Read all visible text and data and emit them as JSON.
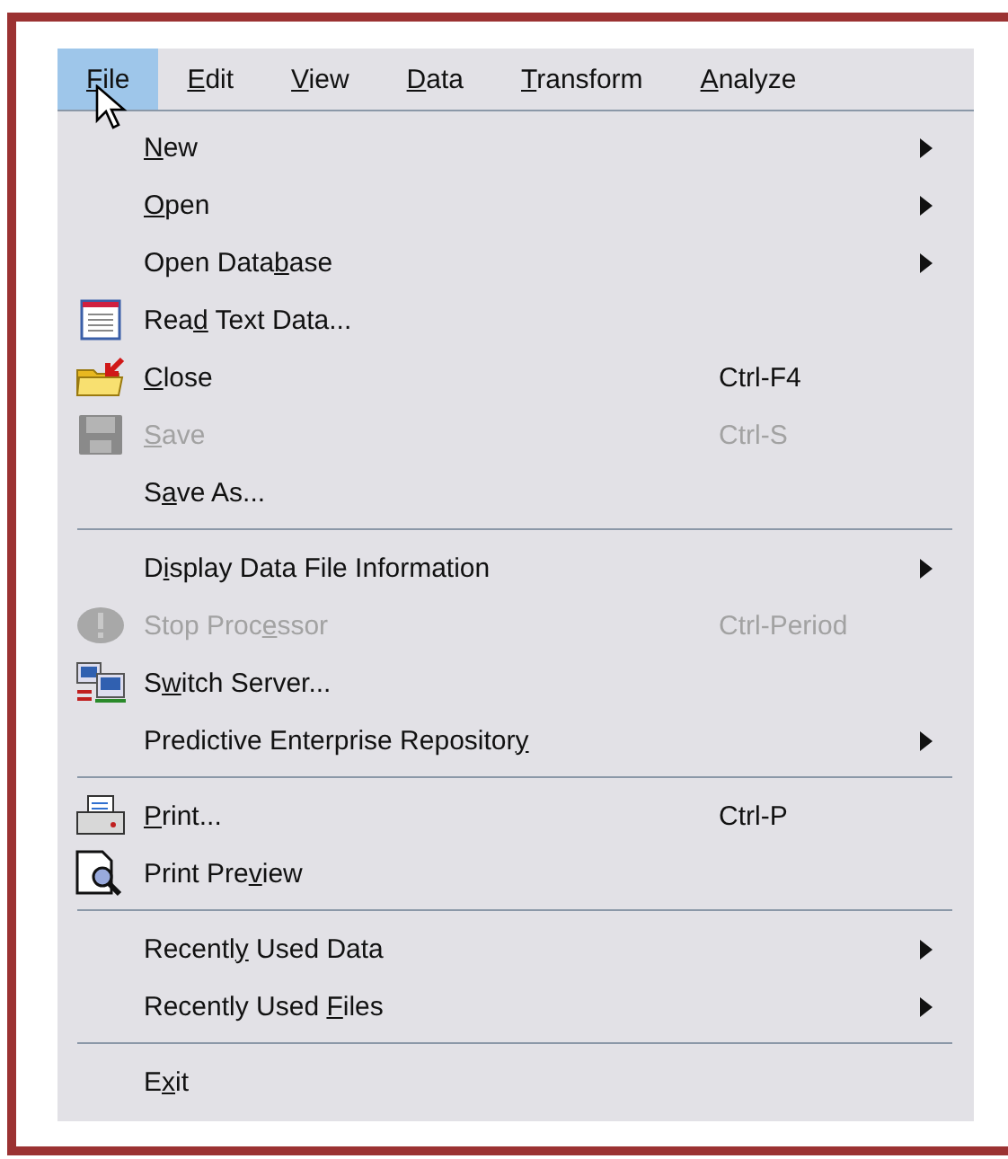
{
  "menubar": [
    {
      "mnemonic": "F",
      "label_rest": "ile",
      "selected": true
    },
    {
      "mnemonic": "E",
      "label_rest": "dit",
      "selected": false
    },
    {
      "mnemonic": "V",
      "label_rest": "iew",
      "selected": false
    },
    {
      "mnemonic": "D",
      "label_rest": "ata",
      "selected": false
    },
    {
      "mnemonic": "T",
      "label_rest": "ransform",
      "selected": false
    },
    {
      "mnemonic": "A",
      "label_rest": "nalyze",
      "selected": false
    }
  ],
  "menu": [
    {
      "kind": "item",
      "mnemonic": "N",
      "label_rest": "ew",
      "submenu": true,
      "disabled": false
    },
    {
      "kind": "item",
      "mnemonic": "O",
      "label_rest": "pen",
      "submenu": true,
      "disabled": false
    },
    {
      "kind": "item",
      "label_start": "Open Data",
      "mnemonic": "b",
      "label_rest": "ase",
      "submenu": true,
      "disabled": false
    },
    {
      "kind": "item",
      "label_start": "Rea",
      "mnemonic": "d",
      "label_rest": " Text Data...",
      "submenu": false,
      "disabled": false
    },
    {
      "kind": "item",
      "mnemonic": "C",
      "label_rest": "lose",
      "shortcut": "Ctrl-F4",
      "submenu": false,
      "disabled": false
    },
    {
      "kind": "item",
      "mnemonic": "S",
      "label_rest": "ave",
      "shortcut": "Ctrl-S",
      "submenu": false,
      "disabled": true
    },
    {
      "kind": "item",
      "label_start": "S",
      "mnemonic": "a",
      "label_rest": "ve As...",
      "submenu": false,
      "disabled": false
    },
    {
      "kind": "separator"
    },
    {
      "kind": "item",
      "label_start": "D",
      "mnemonic": "i",
      "label_rest": "splay Data File Information",
      "submenu": true,
      "disabled": false
    },
    {
      "kind": "item",
      "label_start": "Stop Proc",
      "mnemonic": "e",
      "label_rest": "ssor",
      "shortcut": "Ctrl-Period",
      "submenu": false,
      "disabled": true
    },
    {
      "kind": "item",
      "label_start": "S",
      "mnemonic": "w",
      "label_rest": "itch Server...",
      "submenu": false,
      "disabled": false
    },
    {
      "kind": "item",
      "label_start": "Predictive Enterprise Repositor",
      "mnemonic": "y",
      "submenu": true,
      "disabled": false
    },
    {
      "kind": "separator"
    },
    {
      "kind": "item",
      "mnemonic": "P",
      "label_rest": "rint...",
      "shortcut": "Ctrl-P",
      "submenu": false,
      "disabled": false
    },
    {
      "kind": "item",
      "label_start": "Print Pre",
      "mnemonic": "v",
      "label_rest": "iew",
      "submenu": false,
      "disabled": false
    },
    {
      "kind": "separator"
    },
    {
      "kind": "item",
      "label_start": "Recentl",
      "mnemonic": "y",
      "label_rest": " Used Data",
      "submenu": true,
      "disabled": false
    },
    {
      "kind": "item",
      "label_start": "Recently Used ",
      "mnemonic": "F",
      "label_rest": "iles",
      "submenu": true,
      "disabled": false
    },
    {
      "kind": "separator"
    },
    {
      "kind": "item",
      "label_start": "E",
      "mnemonic": "x",
      "label_rest": "it",
      "submenu": false,
      "disabled": false
    }
  ]
}
